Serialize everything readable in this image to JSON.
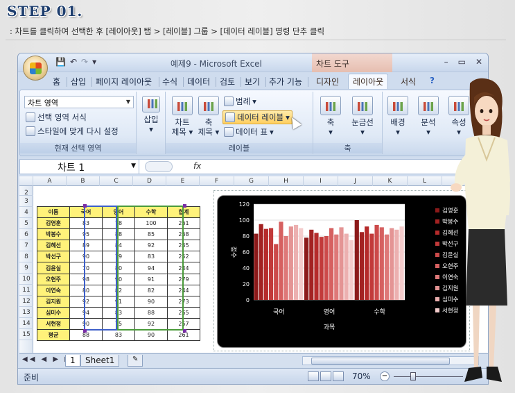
{
  "step": {
    "title": "STEP 01.",
    "description": ": 차트를 클릭하여 선택한 후 [레이아웃] 탭 > [레이블] 그룹 > [데이터 레이블] 명령 단추 클릭"
  },
  "window": {
    "title": "예제9 - Microsoft Excel",
    "context_title": "차트 도구",
    "controls": [
      "–",
      "▭",
      "✕"
    ]
  },
  "tabs": [
    {
      "label": "홈"
    },
    {
      "label": "삽입"
    },
    {
      "label": "페이지 레이아웃"
    },
    {
      "label": "수식"
    },
    {
      "label": "데이터"
    },
    {
      "label": "검토"
    },
    {
      "label": "보기"
    },
    {
      "label": "추가 기능"
    },
    {
      "label": "디자인"
    },
    {
      "label": "레이아웃"
    },
    {
      "label": "서식"
    }
  ],
  "ribbon": {
    "current_selection": {
      "dropdown_value": "차트 영역",
      "format_selection": "선택 영역 서식",
      "reset_style": "스타일에 맞게 다시 설정",
      "group_label": "현재 선택 영역"
    },
    "insert": {
      "label": "삽입"
    },
    "labels": {
      "chart_title": "차트 제목",
      "axis_titles": "축 제목",
      "legend": "범례",
      "data_labels": "데이터 레이블",
      "data_table": "데이터 표",
      "group_label": "레이블"
    },
    "axes": {
      "axes": "축",
      "gridlines": "눈금선",
      "group_label": "축"
    },
    "background": {
      "label": "배경"
    },
    "analysis": {
      "label": "분석"
    },
    "properties": {
      "label": "속성"
    }
  },
  "formula_bar": {
    "name_box": "차트 1",
    "fx": "fx"
  },
  "sheet": {
    "columns": [
      "A",
      "B",
      "C",
      "D",
      "E",
      "F",
      "G",
      "H",
      "I",
      "J",
      "K",
      "L"
    ],
    "rows": [
      "2",
      "3",
      "4",
      "5",
      "6",
      "7",
      "8",
      "9",
      "10",
      "11",
      "12",
      "13",
      "14",
      "15"
    ],
    "table_header": [
      "이름",
      "국어",
      "영어",
      "수학",
      "합계"
    ],
    "table_rows": [
      [
        "김영훈",
        "83",
        "78",
        "100",
        "261"
      ],
      [
        "박봉수",
        "95",
        "88",
        "85",
        "268"
      ],
      [
        "김혜선",
        "89",
        "84",
        "92",
        "265"
      ],
      [
        "박선구",
        "90",
        "79",
        "83",
        "252"
      ],
      [
        "김윤실",
        "70",
        "80",
        "94",
        "244"
      ],
      [
        "오현주",
        "98",
        "90",
        "91",
        "279"
      ],
      [
        "이연숙",
        "80",
        "82",
        "82",
        "244"
      ],
      [
        "김지원",
        "92",
        "91",
        "90",
        "273"
      ],
      [
        "심미수",
        "94",
        "83",
        "88",
        "265"
      ],
      [
        "서현정",
        "90",
        "75",
        "92",
        "257"
      ],
      [
        "평균",
        "88",
        "83",
        "90",
        "261"
      ]
    ]
  },
  "chart_data": {
    "type": "bar",
    "categories": [
      "국어",
      "영어",
      "수학"
    ],
    "series": [
      {
        "name": "김영훈",
        "values": [
          83,
          78,
          100
        ]
      },
      {
        "name": "박봉수",
        "values": [
          95,
          88,
          85
        ]
      },
      {
        "name": "김혜선",
        "values": [
          89,
          84,
          92
        ]
      },
      {
        "name": "박선구",
        "values": [
          90,
          79,
          83
        ]
      },
      {
        "name": "김윤실",
        "values": [
          70,
          80,
          94
        ]
      },
      {
        "name": "오현주",
        "values": [
          98,
          90,
          91
        ]
      },
      {
        "name": "이연숙",
        "values": [
          80,
          82,
          82
        ]
      },
      {
        "name": "김지원",
        "values": [
          92,
          91,
          90
        ]
      },
      {
        "name": "심미수",
        "values": [
          94,
          83,
          88
        ]
      },
      {
        "name": "서현정",
        "values": [
          90,
          75,
          92
        ]
      }
    ],
    "xlabel": "과목",
    "ylabel": "점수",
    "ylim": [
      0,
      120
    ],
    "yticks": [
      0,
      20,
      40,
      60,
      80,
      100,
      120
    ],
    "legend": "right",
    "colors": [
      "#8c1a1a",
      "#a32222",
      "#b52b2b",
      "#c23a3a",
      "#cc4a4a",
      "#d66060",
      "#de7878",
      "#e49494",
      "#ecb0b0",
      "#f4cccc"
    ]
  },
  "sheet_tabs": {
    "tab1": "1",
    "tab2": "Sheet1"
  },
  "status": {
    "ready": "준비",
    "zoom": "70%"
  }
}
